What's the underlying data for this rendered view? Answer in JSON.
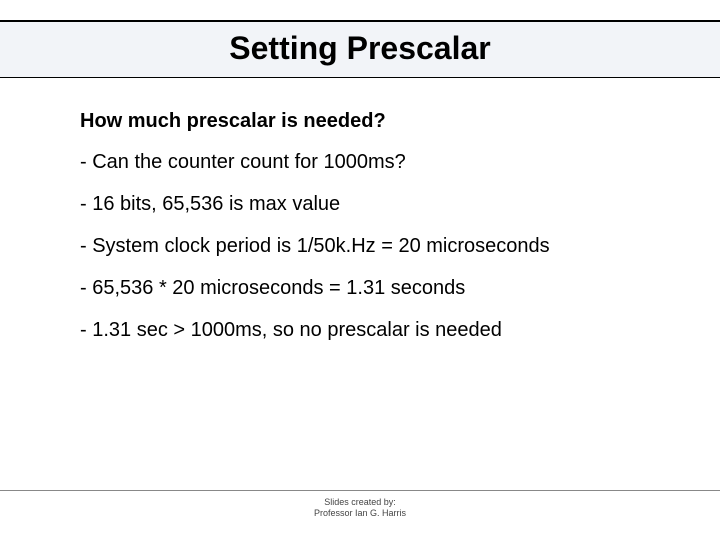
{
  "slide": {
    "title": "Setting Prescalar",
    "question": "How much prescalar is needed?",
    "bullets": [
      "- Can the counter count for 1000ms?",
      "- 16 bits, 65,536 is max value",
      "- System clock period is 1/50k.Hz = 20 microseconds",
      "- 65,536 * 20 microseconds = 1.31 seconds",
      "- 1.31 sec > 1000ms, so no prescalar is needed"
    ],
    "footer": {
      "line1": "Slides created by:",
      "line2": "Professor Ian G. Harris"
    }
  }
}
